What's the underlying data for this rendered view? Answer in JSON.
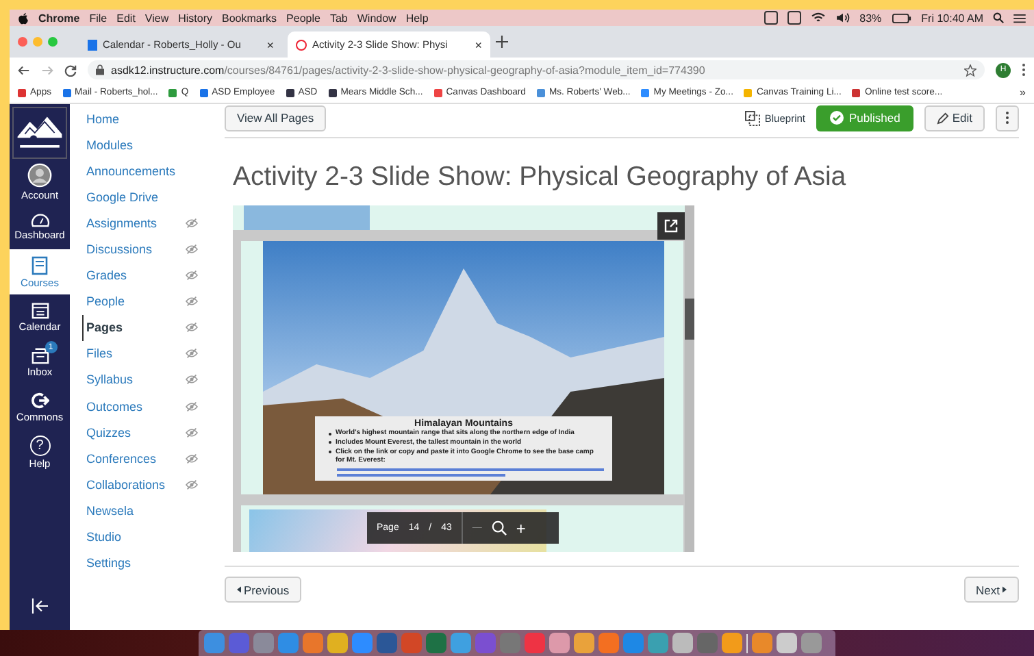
{
  "menu_bar": {
    "items": [
      "Chrome",
      "File",
      "Edit",
      "View",
      "History",
      "Bookmarks",
      "People",
      "Tab",
      "Window",
      "Help"
    ],
    "battery": "83%",
    "clock": "Fri 10:40 AM"
  },
  "browser_tabs": [
    {
      "title": "Calendar - Roberts_Holly - Ou",
      "selected": false,
      "close": "×"
    },
    {
      "title": "Activity 2-3 Slide Show: Physi",
      "selected": true,
      "close": "×"
    }
  ],
  "bookmarks_more": "»",
  "address_bar": {
    "host": "asdk12.instructure.com",
    "path": "/courses/84761/pages/activity-2-3-slide-show-physical-geography-of-asia?module_item_id=774390",
    "profile": "H"
  },
  "bookmarks": [
    "Apps",
    "Mail - Roberts_hol...",
    "Q",
    "ASD Employee",
    "ASD",
    "Mears Middle Sch...",
    "Canvas Dashboard",
    "Ms. Roberts' Web...",
    "My Meetings - Zo...",
    "Canvas Training Li...",
    "Online test score..."
  ],
  "global_nav": [
    {
      "label": "Account",
      "kind": "account",
      "selected": false
    },
    {
      "label": "Dashboard",
      "kind": "dashboard",
      "selected": false
    },
    {
      "label": "Courses",
      "kind": "courses",
      "selected": true
    },
    {
      "label": "Calendar",
      "kind": "calendar",
      "selected": false
    },
    {
      "label": "Inbox",
      "kind": "inbox",
      "selected": false,
      "badge": "1"
    },
    {
      "label": "Commons",
      "kind": "commons",
      "selected": false
    },
    {
      "label": "Help",
      "kind": "help",
      "selected": false,
      "glyph": "?"
    }
  ],
  "course_nav": [
    {
      "label": "Home",
      "hidden": false,
      "selected": false
    },
    {
      "label": "Modules",
      "hidden": false,
      "selected": false
    },
    {
      "label": "Announcements",
      "hidden": false,
      "selected": false
    },
    {
      "label": "Google Drive",
      "hidden": false,
      "selected": false
    },
    {
      "label": "Assignments",
      "hidden": true,
      "selected": false
    },
    {
      "label": "Discussions",
      "hidden": true,
      "selected": false
    },
    {
      "label": "Grades",
      "hidden": true,
      "selected": false
    },
    {
      "label": "People",
      "hidden": true,
      "selected": false
    },
    {
      "label": "Pages",
      "hidden": true,
      "selected": true
    },
    {
      "label": "Files",
      "hidden": true,
      "selected": false
    },
    {
      "label": "Syllabus",
      "hidden": true,
      "selected": false
    },
    {
      "label": "Outcomes",
      "hidden": true,
      "selected": false
    },
    {
      "label": "Quizzes",
      "hidden": true,
      "selected": false
    },
    {
      "label": "Conferences",
      "hidden": true,
      "selected": false
    },
    {
      "label": "Collaborations",
      "hidden": true,
      "selected": false
    },
    {
      "label": "Newsela",
      "hidden": false,
      "selected": false
    },
    {
      "label": "Studio",
      "hidden": false,
      "selected": false
    },
    {
      "label": "Settings",
      "hidden": false,
      "selected": false
    }
  ],
  "toolbar": {
    "view_all": "View All Pages",
    "blueprint": "Blueprint",
    "status": "Published",
    "published": true,
    "edit": "Edit"
  },
  "page_title": "Activity 2-3 Slide Show: Physical Geography of Asia",
  "slide": {
    "title": "Himalayan Mountains",
    "bullets": [
      "World's highest mountain range that sits along the northern edge of India",
      "Includes Mount Everest, the tallest mountain in the world",
      "Click on the link or copy and paste it into Google Chrome to see the base camp for Mt. Everest:"
    ]
  },
  "viewer_toolbar": {
    "page_label": "Page",
    "page": "14",
    "separator": "/",
    "total": "43",
    "minus": "—",
    "plus": "+"
  },
  "pager": {
    "previous": "Previous",
    "next": "Next"
  }
}
